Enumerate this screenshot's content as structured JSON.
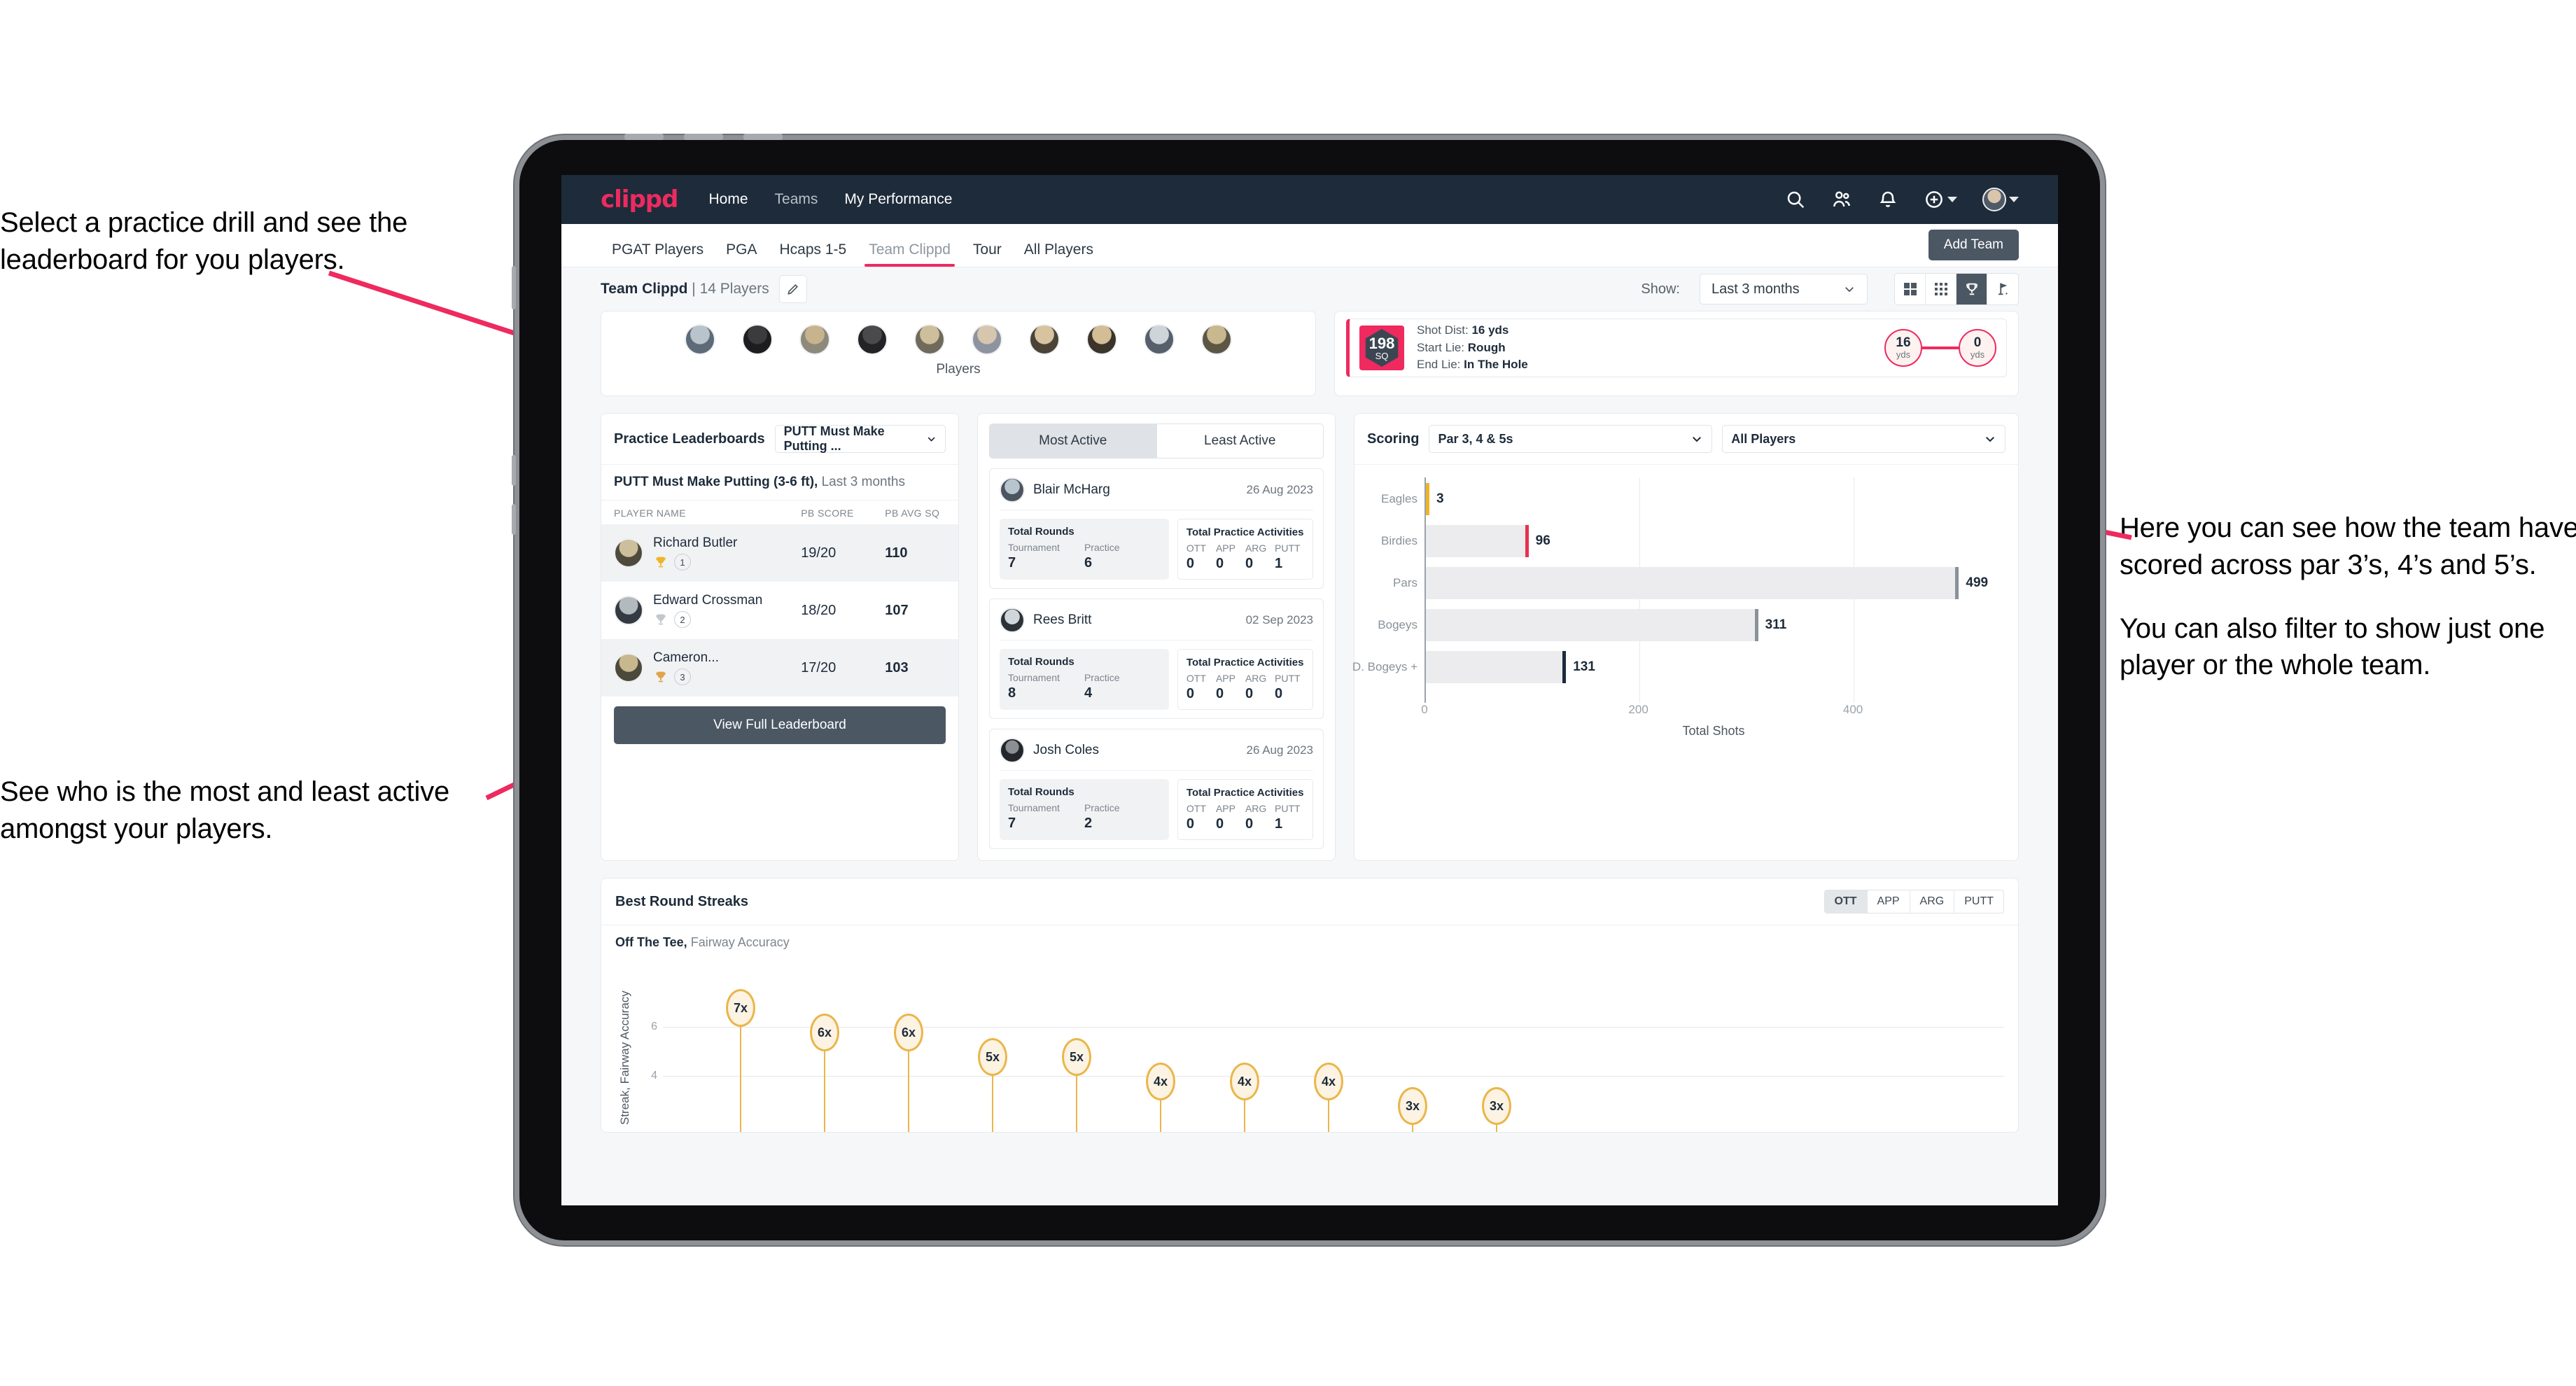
{
  "annotations": {
    "top_left": "Select a practice drill and see the leaderboard for you players.",
    "bottom_left": "See who is the most and least active amongst your players.",
    "right_1": "Here you can see how the team have scored across par 3’s, 4’s and 5’s.",
    "right_2": "You can also filter to show just one player or the whole team."
  },
  "app": {
    "brand": "clippd",
    "nav": [
      {
        "label": "Home",
        "active": true
      },
      {
        "label": "Teams",
        "active": false
      },
      {
        "label": "My Performance",
        "active": true
      }
    ],
    "nav_icons": [
      "search-icon",
      "people-icon",
      "bell-icon",
      "plus-circle-icon",
      "avatar"
    ],
    "tabs": [
      {
        "label": "PGAT Players",
        "active": false
      },
      {
        "label": "PGA",
        "active": false
      },
      {
        "label": "Hcaps 1-5",
        "active": false
      },
      {
        "label": "Team Clippd",
        "active": true
      },
      {
        "label": "Tour",
        "active": false
      },
      {
        "label": "All Players",
        "active": false
      }
    ],
    "add_team_label": "Add Team",
    "team_name": "Team Clippd",
    "team_players": "| 14 Players",
    "edit_icon": "pencil-icon",
    "show_label": "Show:",
    "show_value": "Last 3 months",
    "view_modes": [
      "grid-icon",
      "dots-grid-icon",
      "trophy-icon",
      "flag-icon"
    ],
    "view_active_index": 2
  },
  "players_strip": {
    "caption": "Players",
    "count": 10
  },
  "shot_detail": {
    "sq_value": "198",
    "sq_label": "SQ",
    "lines": [
      {
        "label": "Shot Dist:",
        "value": "16 yds"
      },
      {
        "label": "Start Lie:",
        "value": "Rough"
      },
      {
        "label": "End Lie:",
        "value": "In The Hole"
      }
    ],
    "start_dist": "16",
    "start_unit": "yds",
    "end_dist": "0",
    "end_unit": "yds"
  },
  "leaderboard": {
    "title": "Practice Leaderboards",
    "drill_select": "PUTT Must Make Putting ...",
    "drill_heading": "PUTT Must Make Putting (3-6 ft),",
    "drill_period": "Last 3 months",
    "columns": [
      "PLAYER NAME",
      "PB SCORE",
      "PB AVG SQ"
    ],
    "rows": [
      {
        "name": "Richard Butler",
        "rank": "1",
        "trophy": "gold",
        "score": "19/20",
        "avgsq": "110"
      },
      {
        "name": "Edward Crossman",
        "rank": "2",
        "trophy": "silver",
        "score": "18/20",
        "avgsq": "107"
      },
      {
        "name": "Cameron...",
        "rank": "3",
        "trophy": "bronze",
        "score": "17/20",
        "avgsq": "103"
      }
    ],
    "button": "View Full Leaderboard"
  },
  "activity": {
    "tabs": [
      {
        "label": "Most Active",
        "active": true
      },
      {
        "label": "Least Active",
        "active": false
      }
    ],
    "rounds_title": "Total Rounds",
    "rounds_keys": [
      "Tournament",
      "Practice"
    ],
    "practice_title": "Total Practice Activities",
    "practice_keys": [
      "OTT",
      "APP",
      "ARG",
      "PUTT"
    ],
    "cards": [
      {
        "name": "Blair McHarg",
        "date": "26 Aug 2023",
        "rounds": [
          "7",
          "6"
        ],
        "practice": [
          "0",
          "0",
          "0",
          "1"
        ]
      },
      {
        "name": "Rees Britt",
        "date": "02 Sep 2023",
        "rounds": [
          "8",
          "4"
        ],
        "practice": [
          "0",
          "0",
          "0",
          "0"
        ]
      },
      {
        "name": "Josh Coles",
        "date": "26 Aug 2023",
        "rounds": [
          "7",
          "2"
        ],
        "practice": [
          "0",
          "0",
          "0",
          "1"
        ]
      }
    ]
  },
  "scoring": {
    "title": "Scoring",
    "par_select": "Par 3, 4 & 5s",
    "player_select": "All Players"
  },
  "streaks": {
    "title": "Best Round Streaks",
    "metric_tabs": [
      {
        "label": "OTT",
        "active": true
      },
      {
        "label": "APP",
        "active": false
      },
      {
        "label": "ARG",
        "active": false
      },
      {
        "label": "PUTT",
        "active": false
      }
    ],
    "subtitle_bold": "Off The Tee,",
    "subtitle_rest": "Fairway Accuracy"
  },
  "chart_data": [
    {
      "type": "bar",
      "orientation": "horizontal",
      "title": "Scoring",
      "categories": [
        "Eagles",
        "Birdies",
        "Pars",
        "Bogeys",
        "D. Bogeys +"
      ],
      "values": [
        3,
        96,
        499,
        311,
        131
      ],
      "colors": [
        "#f0b429",
        "#e8314f",
        "#8a9299",
        "#8a9299",
        "#1d2b3a"
      ],
      "xlabel": "Total Shots",
      "ylabel": "",
      "xlim": [
        0,
        540
      ],
      "xticks": [
        0,
        200,
        400
      ],
      "grid": true,
      "legend": false
    },
    {
      "type": "bar",
      "title": "Best Round Streaks",
      "subtitle": "Off The Tee, Fairway Accuracy",
      "ylabel": "Streak, Fairway Accuracy",
      "categories": [
        "1",
        "2",
        "3",
        "4",
        "5",
        "6",
        "7",
        "8",
        "9",
        "10"
      ],
      "values": [
        7,
        6,
        6,
        5,
        5,
        4,
        4,
        4,
        3,
        3
      ],
      "labels": [
        "7x",
        "6x",
        "6x",
        "5x",
        "5x",
        "4x",
        "4x",
        "4x",
        "3x",
        "3x"
      ],
      "yticks": [
        4,
        6
      ],
      "ylim": [
        0,
        7.9
      ],
      "grid": true,
      "legend": false,
      "color": "#eab64a"
    }
  ]
}
